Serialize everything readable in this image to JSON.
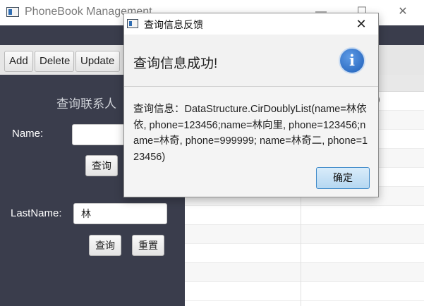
{
  "main_window": {
    "title": "PhoneBook Management",
    "controls": {
      "minimize": "—",
      "maximize": "☐",
      "close": "✕"
    }
  },
  "toolbar": {
    "buttons": [
      "Add",
      "Delete",
      "Update"
    ]
  },
  "left_panel": {
    "heading": "查询联系人",
    "name_label": "Name:",
    "name_value": "",
    "name_query_button": "查询",
    "lastname_label": "LastName:",
    "lastname_value": "林",
    "lastname_query_button": "查询",
    "reset_button": "重置"
  },
  "table": {
    "peek_text": ")"
  },
  "dialog": {
    "title": "查询信息反馈",
    "close": "✕",
    "header_text": "查询信息成功!",
    "info_icon": "i",
    "content": "查询信息：DataStructure.CirDoublyList(name=林依依, phone=123456;name=林向里, phone=123456;name=林奇, phone=999999; name=林奇二, phone=123456)",
    "ok_button": "确定"
  },
  "colors": {
    "dark_panel": "#3a3d4c",
    "info_blue": "#2f6db3",
    "ok_button_border": "#3f8ac9"
  }
}
